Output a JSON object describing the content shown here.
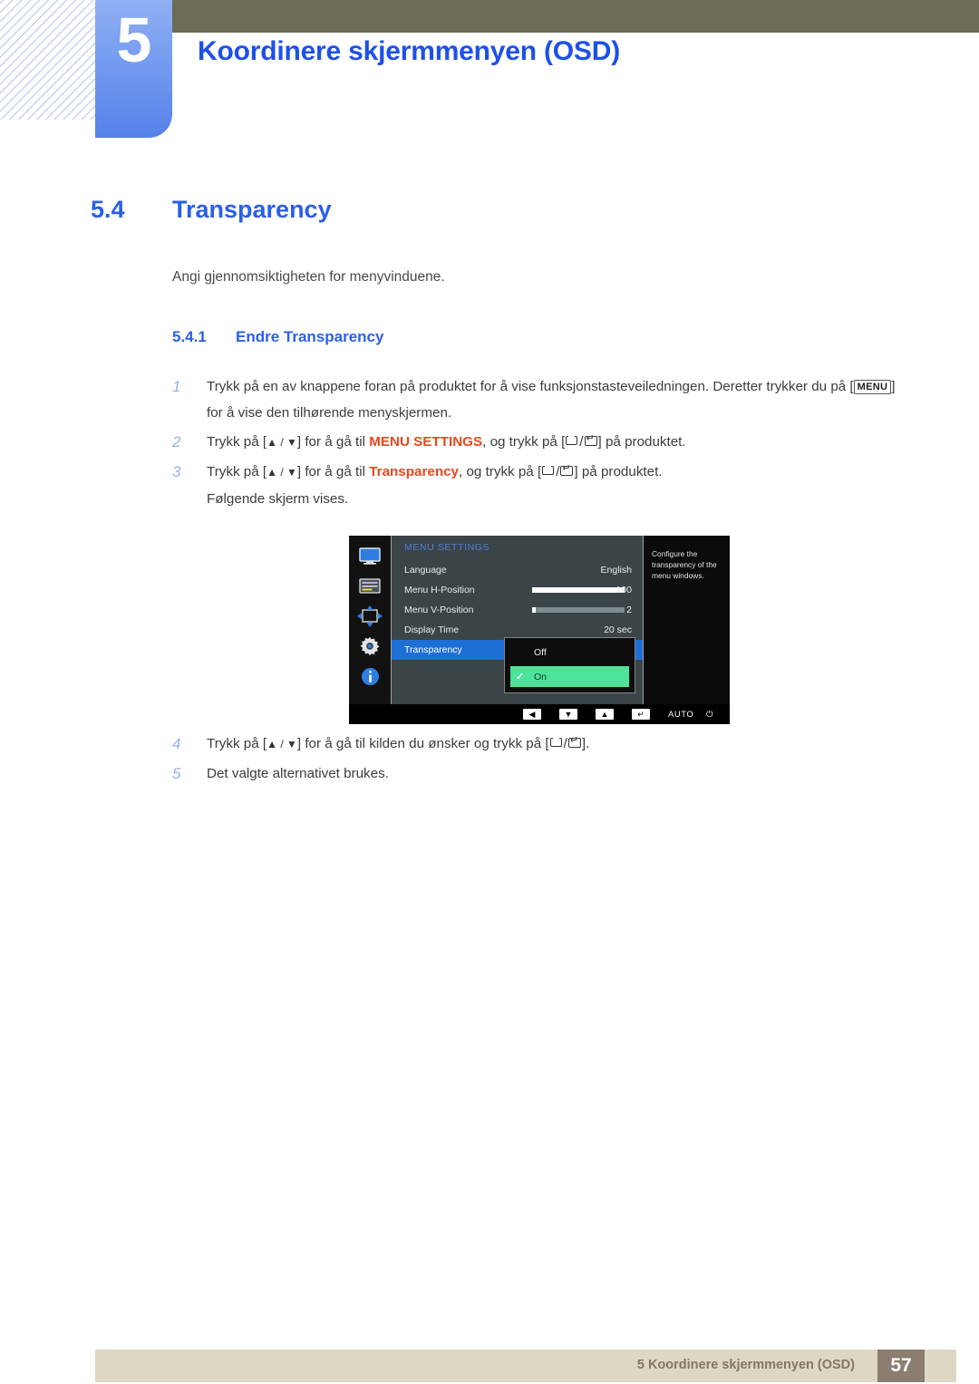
{
  "header": {
    "chapter_number": "5",
    "chapter_title": "Koordinere skjermmenyen (OSD)"
  },
  "section": {
    "number": "5.4",
    "title": "Transparency",
    "lead": "Angi gjennomsiktigheten for menyvinduene."
  },
  "subsection": {
    "number": "5.4.1",
    "title": "Endre Transparency"
  },
  "steps": [
    {
      "num": "1",
      "text_a": "Trykk på en av knappene foran på produktet for å vise funksjonstasteveiledningen. Deretter trykker du på [",
      "kbd": "MENU",
      "text_b": "] for å vise den tilhørende menyskjermen."
    },
    {
      "num": "2",
      "text_a": "Trykk på [",
      "arrows": "▲ / ▼",
      "text_b": "] for å gå til ",
      "highlight": "MENU SETTINGS",
      "text_c": ", og trykk på [",
      "text_d": "] på produktet."
    },
    {
      "num": "3",
      "text_a": "Trykk på [",
      "arrows": "▲ / ▼",
      "text_b": "] for å gå til ",
      "highlight": "Transparency",
      "text_c": ", og trykk på [",
      "text_d": "] på produktet.",
      "followup": "Følgende skjerm vises."
    },
    {
      "num": "4",
      "text_a": "Trykk på [",
      "arrows": "▲ / ▼",
      "text_b": "] for å gå til kilden du ønsker og trykk på [",
      "text_d": "]."
    },
    {
      "num": "5",
      "text_a": "Det valgte alternativet brukes."
    }
  ],
  "osd": {
    "menu_title": "MENU SETTINGS",
    "sidebar_icons": [
      "monitor-icon",
      "menu-list-icon",
      "position-arrows-icon",
      "gear-icon",
      "info-icon"
    ],
    "rows": [
      {
        "label": "Language",
        "value": "English",
        "slider": null,
        "selected": false
      },
      {
        "label": "Menu H-Position",
        "value": "100",
        "slider": 100,
        "selected": false
      },
      {
        "label": "Menu V-Position",
        "value": "2",
        "slider": 3,
        "selected": false
      },
      {
        "label": "Display Time",
        "value": "20 sec",
        "slider": null,
        "selected": false
      },
      {
        "label": "Transparency",
        "value": "",
        "slider": null,
        "selected": true
      }
    ],
    "popup_options": [
      {
        "label": "Off",
        "checked": false
      },
      {
        "label": "On",
        "checked": true
      }
    ],
    "description": "Configure the transparency of the menu windows.",
    "buttons": [
      {
        "name": "back",
        "glyph": "◀"
      },
      {
        "name": "down",
        "glyph": "▼"
      },
      {
        "name": "up",
        "glyph": "▲"
      },
      {
        "name": "enter",
        "glyph": "↵"
      },
      {
        "name": "auto",
        "glyph": "AUTO"
      },
      {
        "name": "power",
        "glyph": "⏻"
      }
    ]
  },
  "footer": {
    "text": "5 Koordinere skjermmenyen (OSD)",
    "page": "57"
  },
  "colors": {
    "accent_blue": "#2a5fe8",
    "olive": "#6d6b56",
    "highlight_orange": "#e8481c",
    "footer_bg": "#dcd8c3",
    "page_box": "#8b7d70",
    "osd_select": "#1d6fd6",
    "osd_on_green": "#4ee39a"
  }
}
